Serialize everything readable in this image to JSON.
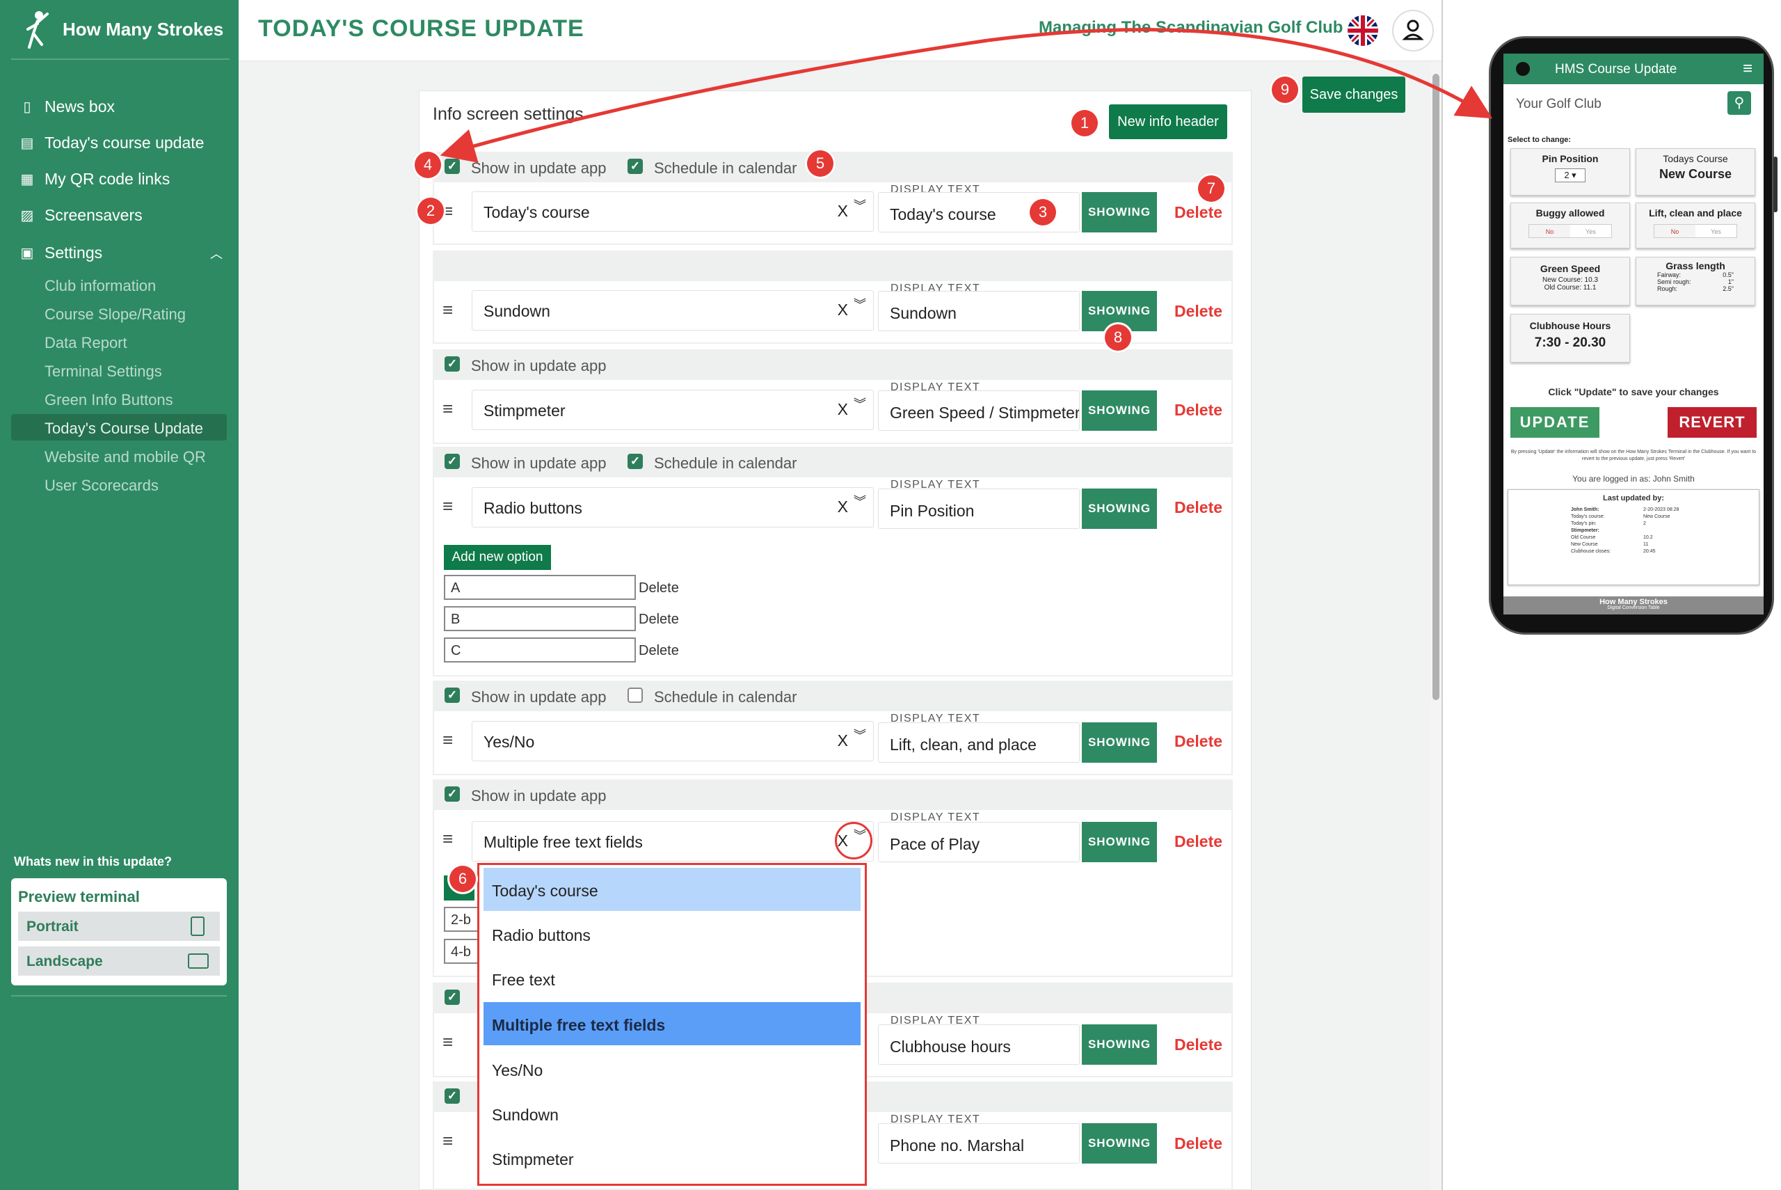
{
  "sidebar": {
    "brand": "How Many Strokes",
    "nav": [
      {
        "label": "News box",
        "icon": "square-icon"
      },
      {
        "label": "Today's course update",
        "icon": "table-icon"
      },
      {
        "label": "My QR code links",
        "icon": "qr-icon"
      },
      {
        "label": "Screensavers",
        "icon": "image-icon"
      },
      {
        "label": "Settings",
        "icon": "clipboard-icon"
      }
    ],
    "settings_sub": [
      "Club information",
      "Course Slope/Rating",
      "Data Report",
      "Terminal Settings",
      "Green Info Buttons",
      "Today's Course Update",
      "Website and mobile QR",
      "User Scorecards"
    ],
    "whats_new": "Whats new in this update?",
    "preview": {
      "title": "Preview terminal",
      "portrait": "Portrait",
      "landscape": "Landscape"
    }
  },
  "header": {
    "title": "TODAY'S COURSE UPDATE",
    "managing": "Managing The Scandinavian Golf Club"
  },
  "panel": {
    "title": "Info screen settings",
    "new_header_button": "New info header",
    "save_button": "Save changes"
  },
  "labels": {
    "show_in_app": "Show in update app",
    "schedule": "Schedule in calendar",
    "display_text": "DISPLAY TEXT",
    "showing": "SHOWING",
    "delete": "Delete",
    "clear": "X",
    "add_option": "Add new option"
  },
  "rows": [
    {
      "type": "Today's course",
      "display": "Today's course"
    },
    {
      "type": "Sundown",
      "display": "Sundown"
    },
    {
      "type": "Stimpmeter",
      "display": "Green Speed / Stimpmeter"
    },
    {
      "type": "Radio buttons",
      "display": "Pin Position"
    },
    {
      "type": "Yes/No",
      "display": "Lift, clean, and place"
    },
    {
      "type": "Multiple free text fields",
      "display": "Pace of Play"
    },
    {
      "type": "",
      "display": "Clubhouse hours"
    },
    {
      "type": "",
      "display": "Phone no. Marshal"
    }
  ],
  "radio_options": [
    "A",
    "B",
    "C"
  ],
  "partial_options": [
    "2-b",
    "4-b"
  ],
  "dropdown": {
    "options": [
      "Today's course",
      "Radio buttons",
      "Free text",
      "Multiple free text fields",
      "Yes/No",
      "Sundown",
      "Stimpmeter"
    ]
  },
  "badges": [
    "1",
    "2",
    "3",
    "4",
    "5",
    "6",
    "7",
    "8",
    "9"
  ],
  "phone": {
    "app_title": "HMS Course Update",
    "club": "Your Golf Club",
    "select": "Select to change:",
    "tiles": {
      "pin": {
        "title": "Pin Position",
        "value": "2"
      },
      "course": {
        "title": "Todays Course",
        "value": "New Course"
      },
      "buggy": {
        "title": "Buggy allowed",
        "no": "No",
        "yes": "Yes"
      },
      "lift": {
        "title": "Lift, clean and place",
        "no": "No",
        "yes": "Yes"
      },
      "green": {
        "title": "Green Speed",
        "l1": "New Course: 10.3",
        "l2": "Old Course: 11.1"
      },
      "grass": {
        "title": "Grass length",
        "rows": [
          [
            "Fairway:",
            "0.5\""
          ],
          [
            "Semi rough:",
            "1\""
          ],
          [
            "Rough:",
            "2.5\""
          ]
        ]
      },
      "club": {
        "title": "Clubhouse Hours",
        "value": "7:30 - 20.30"
      }
    },
    "hint": "Click \"Update\" to save your changes",
    "update": "UPDATE",
    "revert": "REVERT",
    "fine": "By pressing 'Update' the information will show on the How Many Strokes Terminal in the Clubhouse. If you want to revert to the previous update, just press 'Revert'",
    "logged": "You are logged in as: John Smith",
    "last_updated": "Last updated by:",
    "log_rows": [
      [
        "John Smith:",
        "2-20-2023 08:28"
      ],
      [
        "Today's course:",
        "New Course"
      ],
      [
        "Today's pin:",
        "2"
      ],
      [
        "Stimpmeter:",
        ""
      ],
      [
        "Old Course",
        "10.2"
      ],
      [
        "New Course",
        "11"
      ],
      [
        "Clubhouse closes:",
        "20:45"
      ]
    ],
    "footer": "How Many Strokes",
    "footer_sub": "Digital Conversion Table"
  }
}
